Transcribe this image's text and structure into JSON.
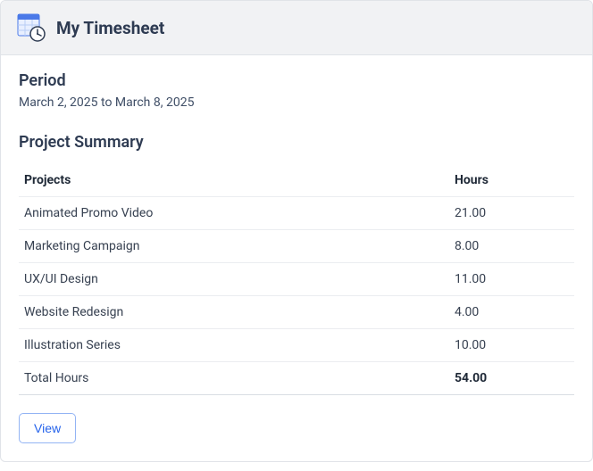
{
  "header": {
    "title": "My Timesheet",
    "icon": "timesheet-clock-icon"
  },
  "period": {
    "label": "Period",
    "text": "March 2, 2025 to March 8, 2025"
  },
  "summary": {
    "heading": "Project Summary",
    "columns": {
      "projects": "Projects",
      "hours": "Hours"
    },
    "rows": [
      {
        "project": "Animated Promo Video",
        "hours": "21.00"
      },
      {
        "project": "Marketing Campaign",
        "hours": "8.00"
      },
      {
        "project": "UX/UI Design",
        "hours": "11.00"
      },
      {
        "project": "Website Redesign",
        "hours": "4.00"
      },
      {
        "project": "Illustration Series",
        "hours": "10.00"
      }
    ],
    "total": {
      "label": "Total Hours",
      "value": "54.00"
    }
  },
  "actions": {
    "view": "View"
  }
}
